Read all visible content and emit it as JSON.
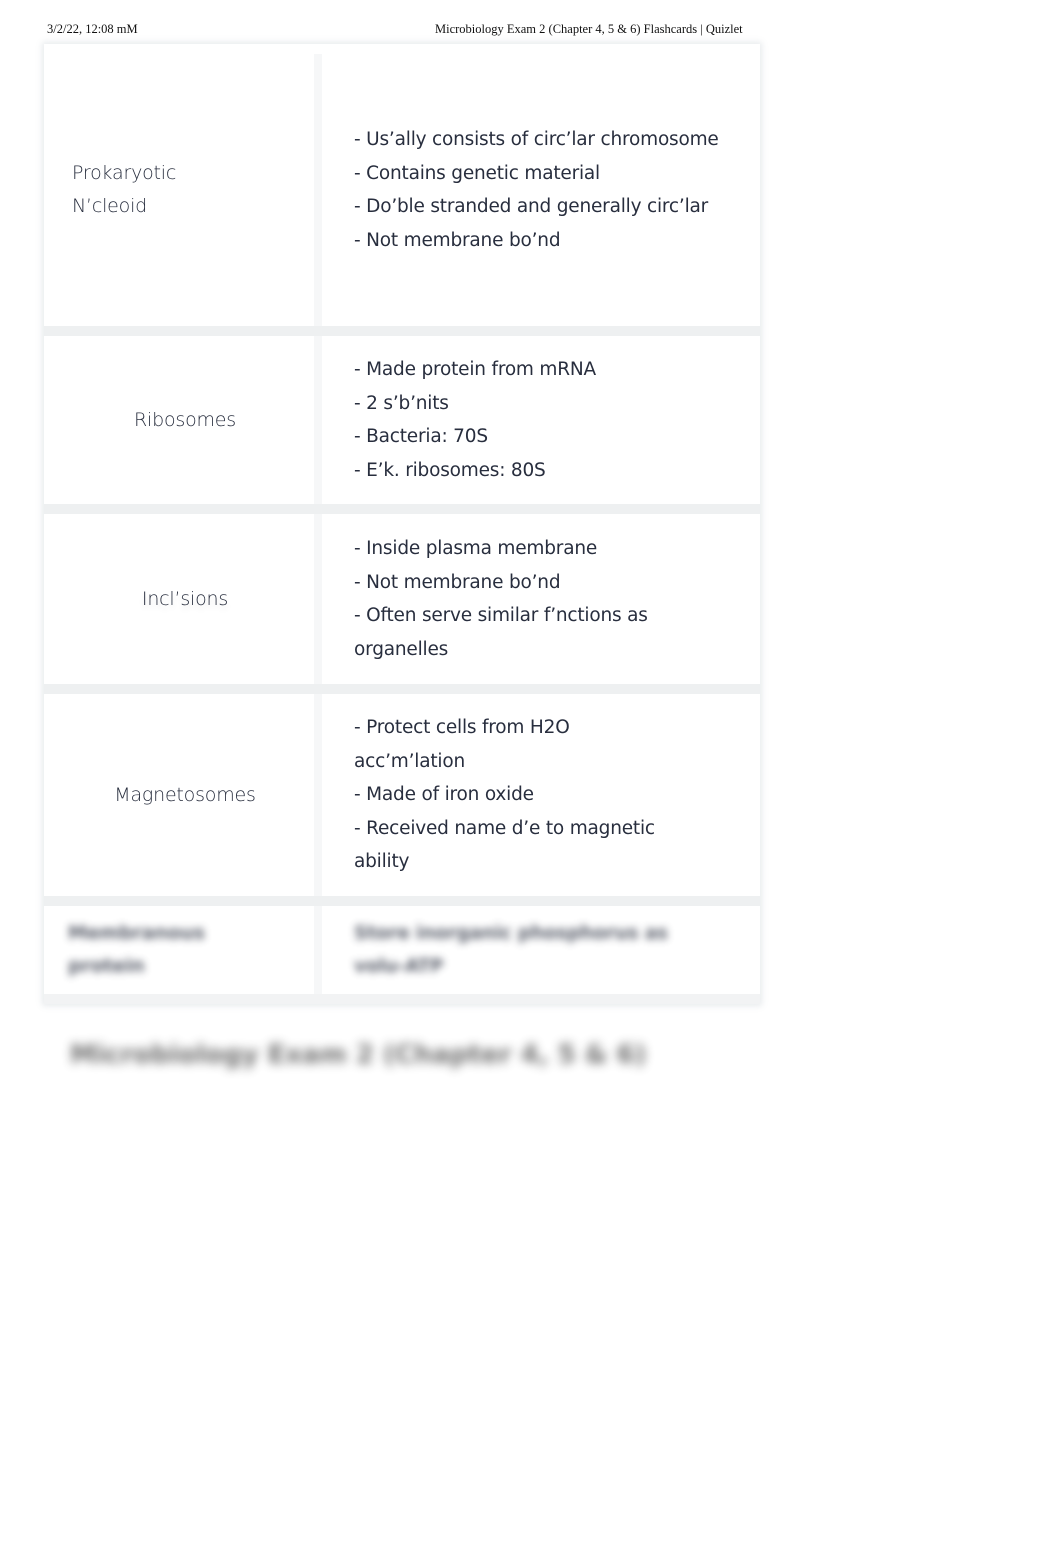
{
  "print_header": {
    "date": "3/2/22, 12:08 mM",
    "title": "Microbiology Exam 2 (Chapter 4, 5 & 6) Flashcards | Quizlet"
  },
  "cards": [
    {
      "term": "Prokaryotic N’cleoid",
      "definition_lines": [
        "- Us’ally consists of circ’lar chromosome",
        "- Contains genetic material",
        "- Do’ble stranded and generally circ’lar",
        "- Not membrane bo’nd"
      ]
    },
    {
      "term": "Ribosomes",
      "definition_lines": [
        "- Made protein from mRNA",
        "- 2 s’b’nits",
        "- Bacteria: 70S",
        "- E’k. ribosomes: 80S"
      ]
    },
    {
      "term": "Incl’sions",
      "definition_lines": [
        "- Inside plasma membrane",
        "- Not membrane bo’nd",
        "- Often serve similar f’nctions as organelles"
      ]
    },
    {
      "term": "Magnetosomes",
      "definition_lines": [
        "- Protect cells from H2O acc’m’lation",
        "- Made of iron oxide",
        "- Received name d’e to magnetic ability"
      ]
    },
    {
      "term": "Membranous protein",
      "definition_lines": [
        "Store inorganic phosphorus as",
        "volu-ATP"
      ],
      "blurred": true
    }
  ],
  "blurred_section_heading": "Microbiology Exam 2 (Chapter 4, 5 & 6)"
}
